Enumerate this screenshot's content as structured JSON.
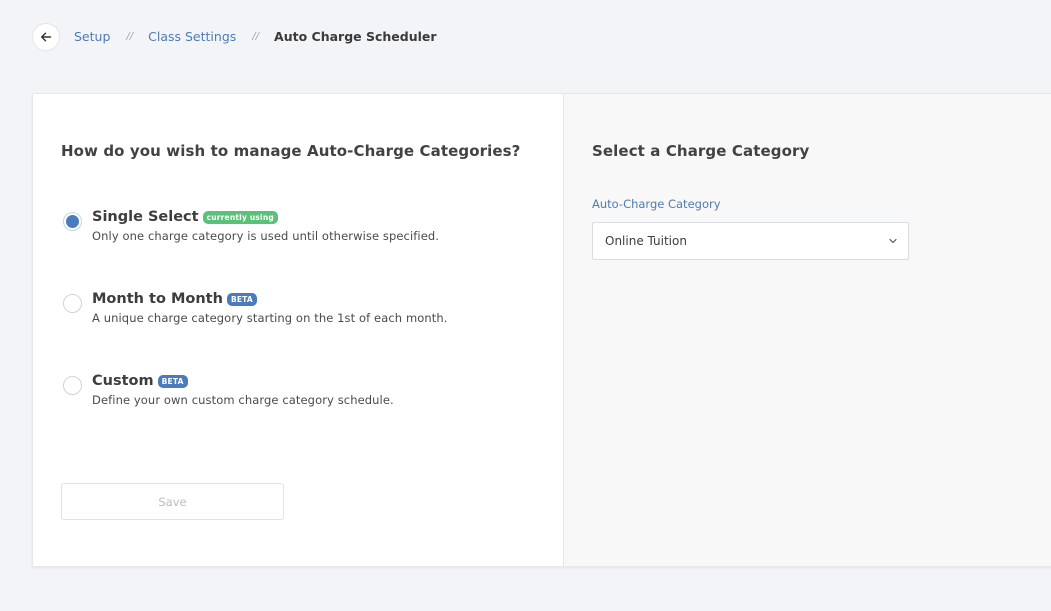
{
  "breadcrumb": {
    "back_icon": "arrow-left-icon",
    "items": [
      "Setup",
      "Class Settings"
    ],
    "separator": "//",
    "current": "Auto Charge Scheduler"
  },
  "left": {
    "heading": "How do you wish to manage Auto-Charge Categories?",
    "options": [
      {
        "title": "Single Select",
        "badge": "currently using",
        "badge_color": "#5cc178",
        "description": "Only one charge category is used until otherwise specified.",
        "selected": true
      },
      {
        "title": "Month to Month",
        "badge": "BETA",
        "badge_color": "#4a7cbc",
        "description": "A unique charge category starting on the 1st of each month.",
        "selected": false
      },
      {
        "title": "Custom",
        "badge": "BETA",
        "badge_color": "#4a7cbc",
        "description": "Define your own custom charge category schedule.",
        "selected": false
      }
    ],
    "save_label": "Save"
  },
  "right": {
    "heading": "Select a Charge Category",
    "field_label": "Auto-Charge Category",
    "selected_value": "Online Tuition",
    "dropdown_icon": "chevron-down-icon"
  },
  "colors": {
    "accent": "#4a7cbc",
    "link": "#4f7bb0",
    "success": "#5cc178",
    "background": "#f3f4f7"
  }
}
